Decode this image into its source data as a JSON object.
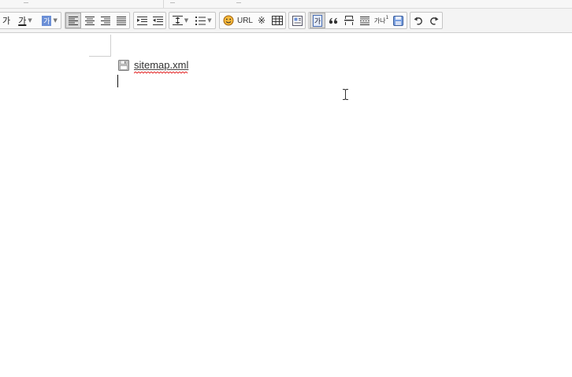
{
  "toolbar": {
    "font_size_glyph": "가",
    "underline_glyph": "가",
    "bgcolor_glyph": "가",
    "url_label": "URL",
    "special_char_glyph": "※",
    "paragraph_glyph": "가",
    "superscript_glyph": "가나",
    "superscript_mark": "1"
  },
  "document": {
    "attachment_filename": "sitemap.xml"
  },
  "colors": {
    "highlight_blue": "#6b8fd6",
    "spellcheck_red": "#e02020"
  }
}
